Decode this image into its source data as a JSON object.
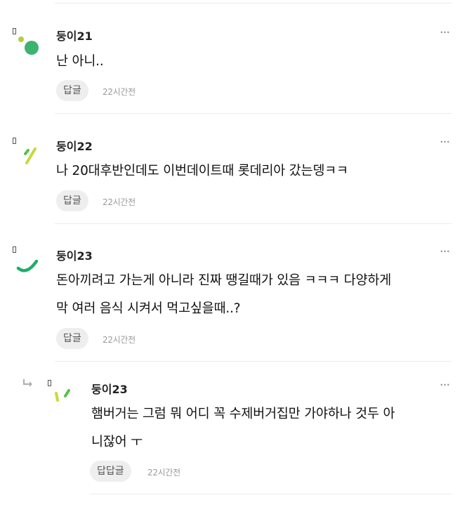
{
  "comments": [
    {
      "name": "둥이21",
      "text": "난 아니..",
      "reply_label": "답글",
      "time": "22시간전",
      "more": "···"
    },
    {
      "name": "둥이22",
      "text": "나 20대후반인데도 이번데이트때 롯데리아 갔는뎅ㅋㅋ",
      "reply_label": "답글",
      "time": "22시간전",
      "more": "···"
    },
    {
      "name": "둥이23",
      "text_line1": "돈아끼려고 가는게 아니라 진짜 땡길때가 있음 ㅋㅋㅋ 다양하게",
      "text_line2": "막 여러 음식 시켜서 먹고싶을때..?",
      "reply_label": "답글",
      "time": "22시간전",
      "more": "···"
    }
  ],
  "reply": {
    "name": "둥이23",
    "text_line1": "햄버거는 그럼 뭐 어디 꼭 수제버거집만 가야하나 것두 아",
    "text_line2": "니잖어 ㅜ",
    "reply_label": "답답글",
    "time": "22시간전",
    "more": "···"
  },
  "colors": {
    "avatar1": "#3cb371",
    "avatar2_yellow": "#c8d93a",
    "avatar2_green": "#5bbf4a",
    "avatar3": "#1fae6a"
  }
}
